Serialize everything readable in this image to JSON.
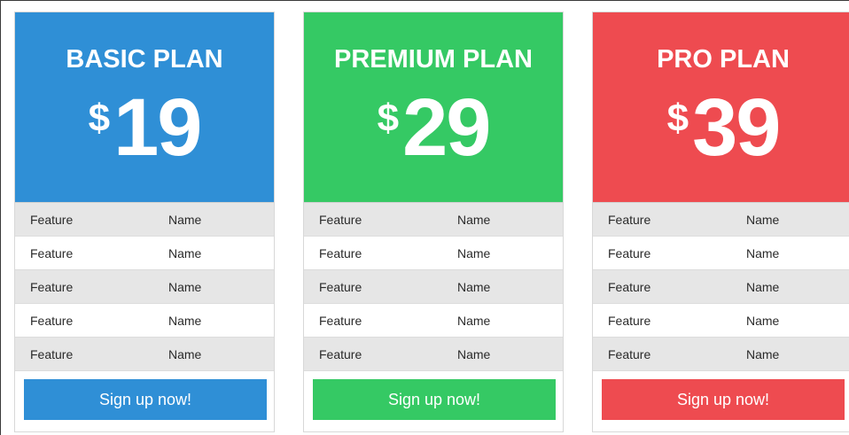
{
  "plans": [
    {
      "name": "BASIC PLAN",
      "currency": "$",
      "amount": "19",
      "color": "#2f8fd6",
      "features": [
        {
          "label": "Feature",
          "value": "Name"
        },
        {
          "label": "Feature",
          "value": "Name"
        },
        {
          "label": "Feature",
          "value": "Name"
        },
        {
          "label": "Feature",
          "value": "Name"
        },
        {
          "label": "Feature",
          "value": "Name"
        }
      ],
      "cta": "Sign up now!"
    },
    {
      "name": "PREMIUM PLAN",
      "currency": "$",
      "amount": "29",
      "color": "#35c964",
      "features": [
        {
          "label": "Feature",
          "value": "Name"
        },
        {
          "label": "Feature",
          "value": "Name"
        },
        {
          "label": "Feature",
          "value": "Name"
        },
        {
          "label": "Feature",
          "value": "Name"
        },
        {
          "label": "Feature",
          "value": "Name"
        }
      ],
      "cta": "Sign up now!"
    },
    {
      "name": "PRO PLAN",
      "currency": "$",
      "amount": "39",
      "color": "#ee4b50",
      "features": [
        {
          "label": "Feature",
          "value": "Name"
        },
        {
          "label": "Feature",
          "value": "Name"
        },
        {
          "label": "Feature",
          "value": "Name"
        },
        {
          "label": "Feature",
          "value": "Name"
        },
        {
          "label": "Feature",
          "value": "Name"
        }
      ],
      "cta": "Sign up now!"
    }
  ]
}
